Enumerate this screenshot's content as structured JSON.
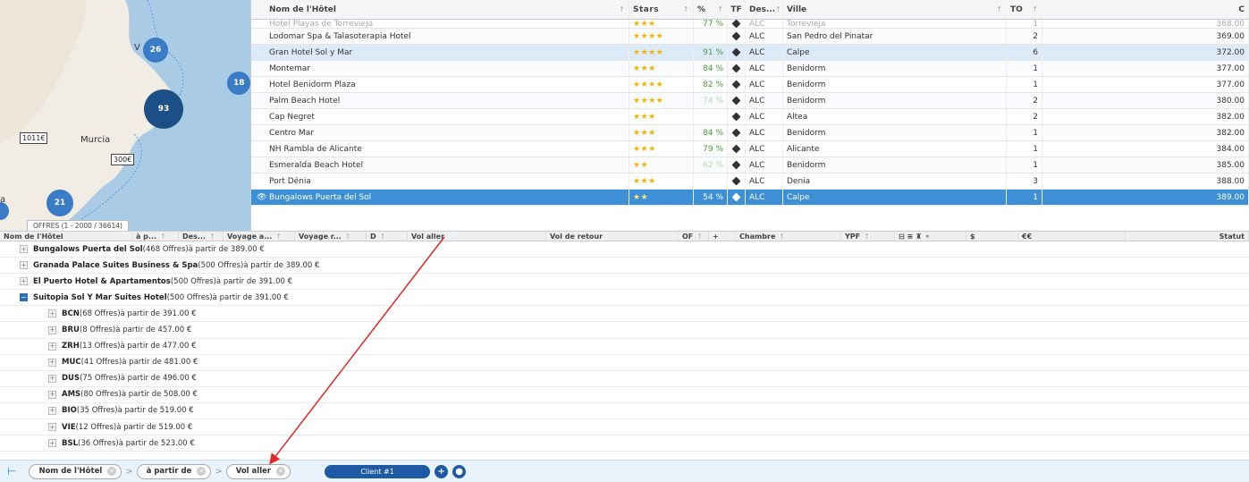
{
  "map": {
    "offres_label": "OFFRES (1 - 2000 / 36614)",
    "clusters": [
      {
        "label": "26"
      },
      {
        "label": "18"
      },
      {
        "label": "93"
      },
      {
        "label": "21"
      }
    ],
    "price_tags": [
      "1011€",
      "300€"
    ],
    "places": [
      "Murcia"
    ],
    "fragments": [
      "V",
      "a"
    ]
  },
  "hotels": {
    "headers": {
      "name": "Nom de l'Hôtel",
      "stars": "Stars",
      "pct": "%",
      "tf": "TF",
      "des": "Des...",
      "ville": "Ville",
      "to": "TO",
      "price": "C"
    },
    "partial_row": {
      "name": "Hotel Playas de Torrevieja",
      "stars": "★★★",
      "pct": "77 %",
      "des": "ALC",
      "ville": "Torrevieja",
      "to": "1",
      "price": "368.00"
    },
    "rows": [
      {
        "name": "Lodomar Spa & Talasoterapia Hotel",
        "stars": "★★★★",
        "pct": "",
        "pct_faded": false,
        "des": "ALC",
        "ville": "San Pedro del Pinatar",
        "to": "2",
        "price": "369.00",
        "state": ""
      },
      {
        "name": "Gran Hotel Sol y Mar",
        "stars": "★★★★",
        "pct": "91 %",
        "pct_faded": false,
        "des": "ALC",
        "ville": "Calpe",
        "to": "6",
        "price": "372.00",
        "state": "hl"
      },
      {
        "name": "Montemar",
        "stars": "★★★",
        "pct": "84 %",
        "pct_faded": false,
        "des": "ALC",
        "ville": "Benidorm",
        "to": "1",
        "price": "377.00",
        "state": ""
      },
      {
        "name": "Hotel Benidorm Plaza",
        "stars": "★★★★",
        "pct": "82 %",
        "pct_faded": false,
        "des": "ALC",
        "ville": "Benidorm",
        "to": "1",
        "price": "377.00",
        "state": ""
      },
      {
        "name": "Palm Beach Hotel",
        "stars": "★★★★",
        "pct": "74 %",
        "pct_faded": true,
        "des": "ALC",
        "ville": "Benidorm",
        "to": "2",
        "price": "380.00",
        "state": ""
      },
      {
        "name": "Cap Negret",
        "stars": "★★★",
        "pct": "",
        "pct_faded": false,
        "des": "ALC",
        "ville": "Altea",
        "to": "2",
        "price": "382.00",
        "state": ""
      },
      {
        "name": "Centro Mar",
        "stars": "★★★",
        "pct": "84 %",
        "pct_faded": false,
        "des": "ALC",
        "ville": "Benidorm",
        "to": "1",
        "price": "382.00",
        "state": ""
      },
      {
        "name": "NH Rambla de Alicante",
        "stars": "★★★",
        "pct": "79 %",
        "pct_faded": false,
        "des": "ALC",
        "ville": "Alicante",
        "to": "1",
        "price": "384.00",
        "state": ""
      },
      {
        "name": "Esmeralda Beach Hotel",
        "stars": "★★",
        "pct": "62 %",
        "pct_faded": true,
        "des": "ALC",
        "ville": "Benidorm",
        "to": "1",
        "price": "385.00",
        "state": ""
      },
      {
        "name": "Port Dénia",
        "stars": "★★★",
        "pct": "",
        "pct_faded": false,
        "des": "ALC",
        "ville": "Denia",
        "to": "3",
        "price": "388.00",
        "state": ""
      },
      {
        "name": "Bungalows Puerta del Sol",
        "stars": "★★",
        "pct": "54 %",
        "pct_faded": false,
        "des": "ALC",
        "ville": "Calpe",
        "to": "1",
        "price": "389.00",
        "state": "sel"
      }
    ]
  },
  "offers": {
    "headers": [
      {
        "label": "Nom de l'Hôtel",
        "sort": ""
      },
      {
        "label": "à p...",
        "sort": "↑"
      },
      {
        "label": "Des...",
        "sort": "↑"
      },
      {
        "label": "Voyage a...",
        "sort": "↑"
      },
      {
        "label": "Voyage r...",
        "sort": "↑"
      },
      {
        "label": "D",
        "sort": "↑"
      },
      {
        "label": "Vol aller",
        "sort": ""
      },
      {
        "label": "Vol de retour",
        "sort": ""
      },
      {
        "label": "OF",
        "sort": "↑"
      },
      {
        "label": "+",
        "sort": ""
      },
      {
        "label": "Chambre",
        "sort": "↑"
      },
      {
        "label": "YPF",
        "sort": "↑"
      },
      {
        "label": "⊟ ≡ ♜ ⚬",
        "sort": ""
      },
      {
        "label": "$",
        "sort": ""
      },
      {
        "label": "€€",
        "sort": ""
      },
      {
        "label": "Statut",
        "sort": ""
      }
    ],
    "groups": [
      {
        "level": 1,
        "open": false,
        "name": "Bungalows Puerta del Sol",
        "info": " (468 Offres)à partir de 389.00 €"
      },
      {
        "level": 1,
        "open": false,
        "name": "Granada Palace Suites Business & Spa",
        "info": " (500 Offres)à partir de 389.00 €"
      },
      {
        "level": 1,
        "open": false,
        "name": "El Puerto Hotel & Apartamentos",
        "info": " (500 Offres)à partir de 391.00 €"
      },
      {
        "level": 1,
        "open": true,
        "name": "Suitopia Sol Y Mar Suites Hotel",
        "info": " (500 Offres)à partir de 391.00 €"
      },
      {
        "level": 2,
        "open": false,
        "name": "BCN",
        "info": " (68 Offres)à partir de 391.00 €"
      },
      {
        "level": 2,
        "open": false,
        "name": "BRU",
        "info": " (8 Offres)à partir de 457.00 €"
      },
      {
        "level": 2,
        "open": false,
        "name": "ZRH",
        "info": " (13 Offres)à partir de 477.00 €"
      },
      {
        "level": 2,
        "open": false,
        "name": "MUC",
        "info": " (41 Offres)à partir de 481.00 €"
      },
      {
        "level": 2,
        "open": false,
        "name": "DUS",
        "info": " (75 Offres)à partir de 496.00 €"
      },
      {
        "level": 2,
        "open": false,
        "name": "AMS",
        "info": " (80 Offres)à partir de 508.00 €"
      },
      {
        "level": 2,
        "open": false,
        "name": "BIO",
        "info": " (35 Offres)à partir de 519.00 €"
      },
      {
        "level": 2,
        "open": false,
        "name": "VIE",
        "info": " (12 Offres)à partir de 519.00 €"
      },
      {
        "level": 2,
        "open": false,
        "name": "BSL",
        "info": " (36 Offres)à partir de 523.00 €"
      }
    ]
  },
  "toolbar": {
    "chips": [
      "Nom de l'Hôtel",
      "à partir de",
      "Vol aller"
    ],
    "client_label": "Client #1",
    "plus_glyph": "+",
    "person_glyph": "●"
  },
  "colors": {
    "selected_row": "#3d8fd6",
    "highlight_row": "#ddeaf7",
    "client_button": "#1f5aa6",
    "annotation_arrow": "#e0282a"
  }
}
